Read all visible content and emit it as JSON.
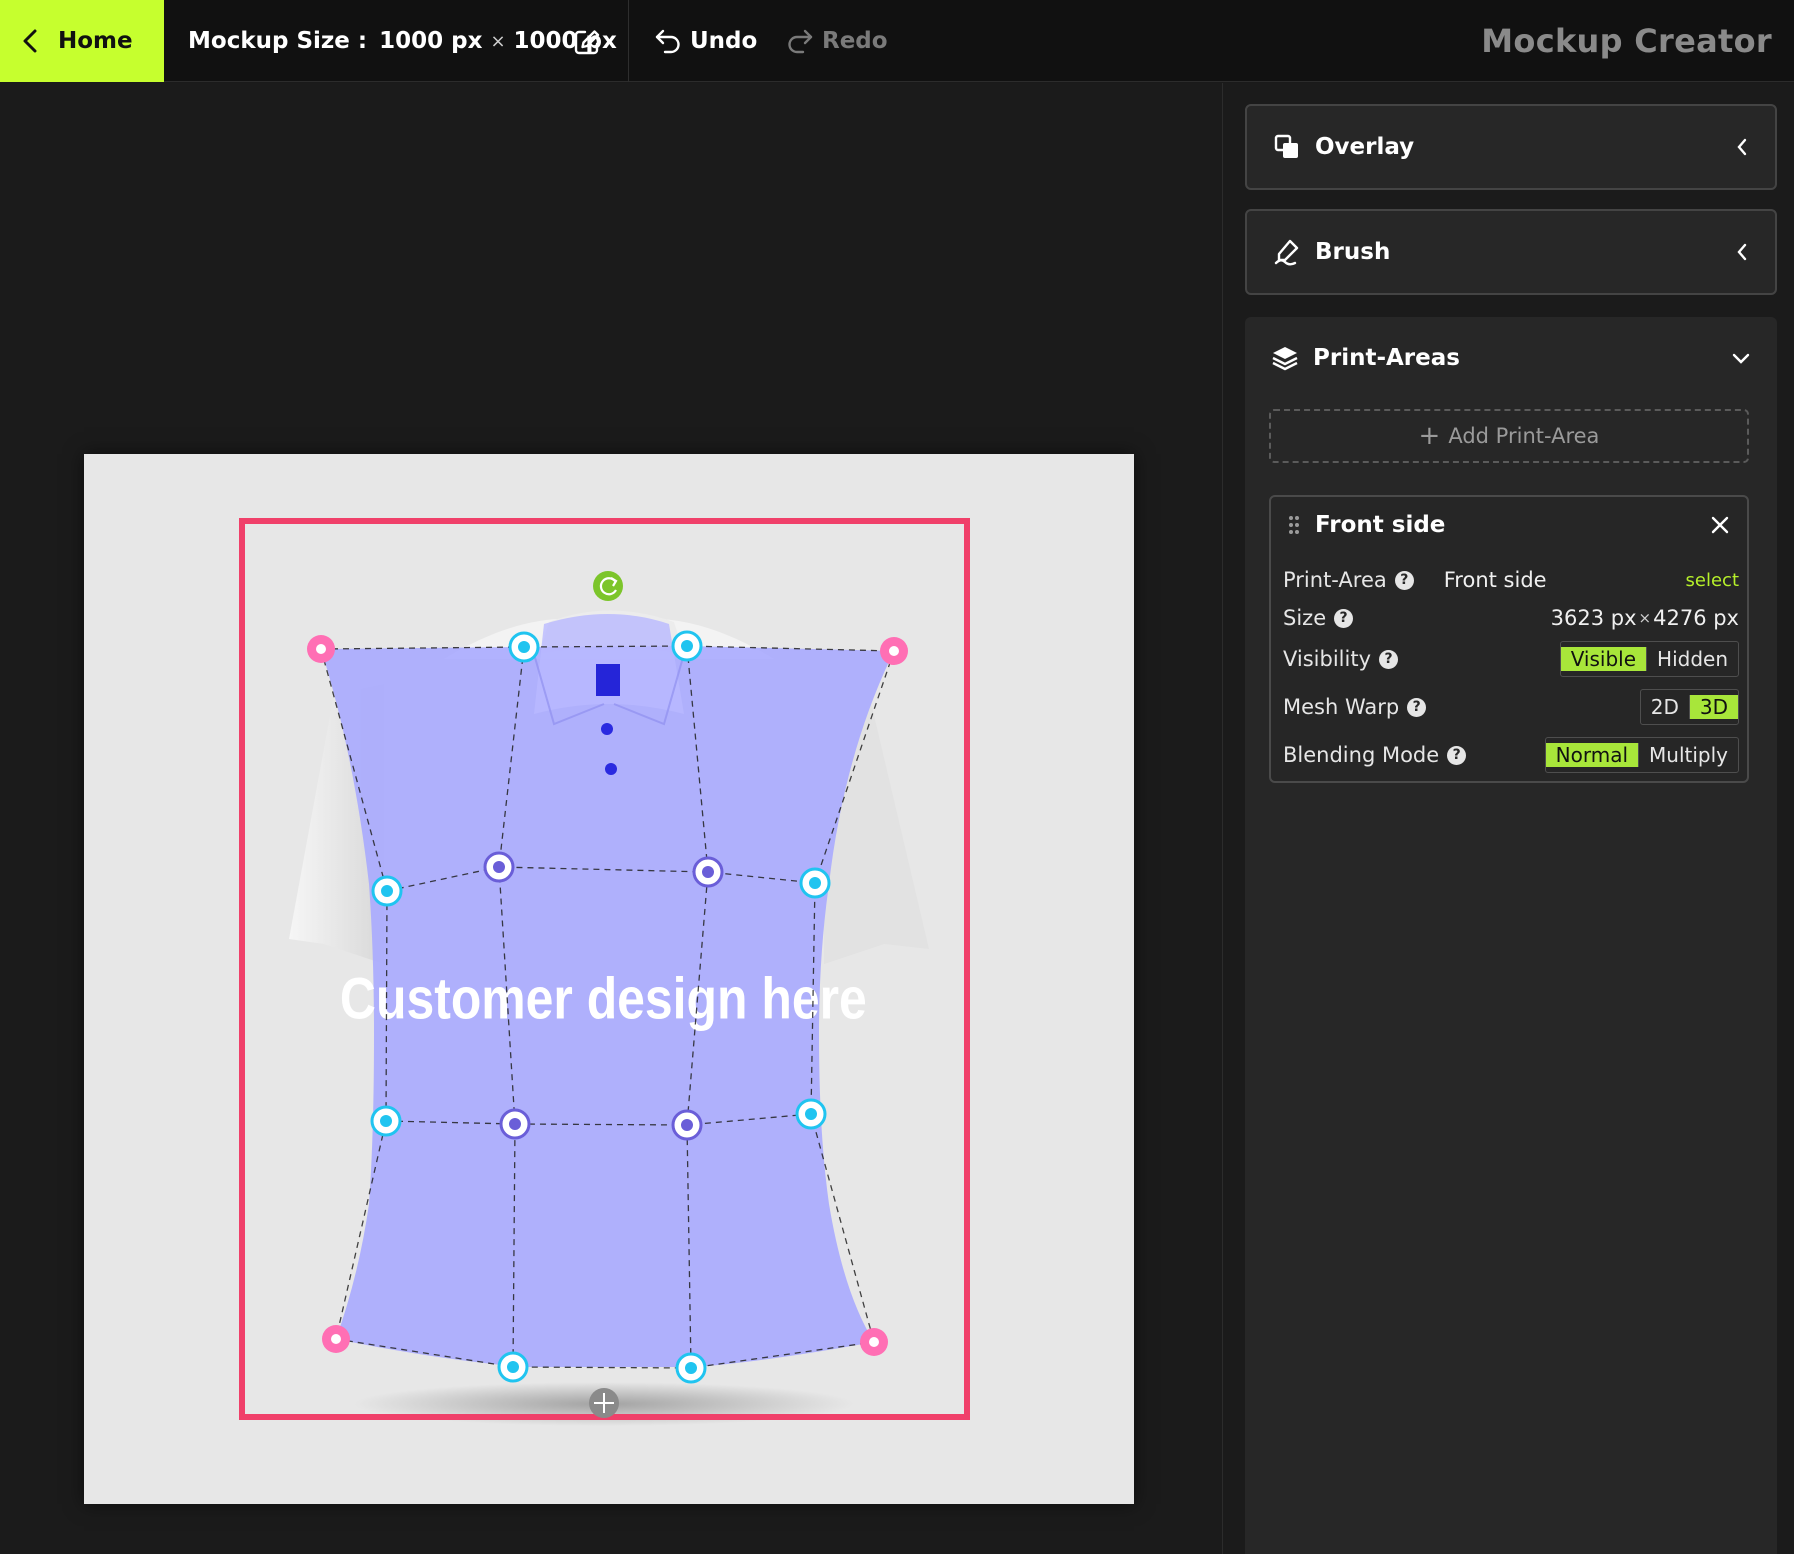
{
  "topbar": {
    "home_label": "Home",
    "mockup_size_label": "Mockup Size :",
    "width": "1000 px",
    "times": "×",
    "height": "1000 px",
    "undo_label": "Undo",
    "redo_label": "Redo",
    "app_title": "Mockup Creator"
  },
  "canvas": {
    "design_text": "Customer design here",
    "colors": {
      "board_bg": "#e7e7e7",
      "selection_frame": "#f0406a",
      "mesh_fill": "#a7a8ff",
      "corner_handle": "#ff6fb4",
      "edge_handle": "#20c4f0",
      "inner_handle": "#6a5ed8",
      "rotate_handle": "#7cc52b"
    }
  },
  "panel": {
    "overlay_label": "Overlay",
    "brush_label": "Brush",
    "print_areas_label": "Print-Areas",
    "add_print_area_label": "Add Print-Area",
    "card": {
      "title": "Front side",
      "print_area_label": "Print-Area",
      "print_area_value": "Front side",
      "select_label": "select",
      "size_label": "Size",
      "size_w": "3623 px",
      "size_x": "×",
      "size_h": "4276 px",
      "visibility_label": "Visibility",
      "visibility_options": [
        "Visible",
        "Hidden"
      ],
      "visibility_selected": "Visible",
      "mesh_warp_label": "Mesh Warp",
      "mesh_warp_options": [
        "2D",
        "3D"
      ],
      "mesh_warp_selected": "3D",
      "blending_label": "Blending Mode",
      "blending_options": [
        "Normal",
        "Multiply"
      ],
      "blending_selected": "Normal"
    }
  },
  "icons": {
    "home": "chevron-left-icon",
    "edit": "edit-icon",
    "undo": "undo-icon",
    "redo": "redo-icon",
    "overlay": "overlay-icon",
    "brush": "brush-icon",
    "print_areas": "layers-icon",
    "help": "help-icon",
    "drag": "drag-handle-icon",
    "close": "close-icon"
  },
  "accent_color": "#c6ff2e"
}
